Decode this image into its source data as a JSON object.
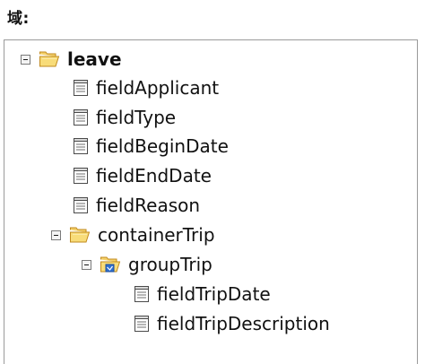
{
  "heading": "域:",
  "tree": {
    "root": {
      "label": "leave",
      "icon": "open-folder-icon",
      "expanded": true
    },
    "fields": [
      {
        "label": "fieldApplicant",
        "icon": "field-document-icon"
      },
      {
        "label": "fieldType",
        "icon": "field-document-icon"
      },
      {
        "label": "fieldBeginDate",
        "icon": "field-document-icon"
      },
      {
        "label": "fieldEndDate",
        "icon": "field-document-icon"
      },
      {
        "label": "fieldReason",
        "icon": "field-document-icon"
      }
    ],
    "container": {
      "label": "containerTrip",
      "icon": "open-folder-icon",
      "expanded": true,
      "group": {
        "label": "groupTrip",
        "icon": "group-folder-icon",
        "expanded": true,
        "fields": [
          {
            "label": "fieldTripDate",
            "icon": "field-document-icon"
          },
          {
            "label": "fieldTripDescription",
            "icon": "field-document-icon"
          }
        ]
      }
    }
  },
  "colors": {
    "folder_fill": "#f6d36b",
    "folder_stroke": "#c18a1d",
    "group_badge": "#2f6fd0",
    "border": "#9a9a9a"
  }
}
